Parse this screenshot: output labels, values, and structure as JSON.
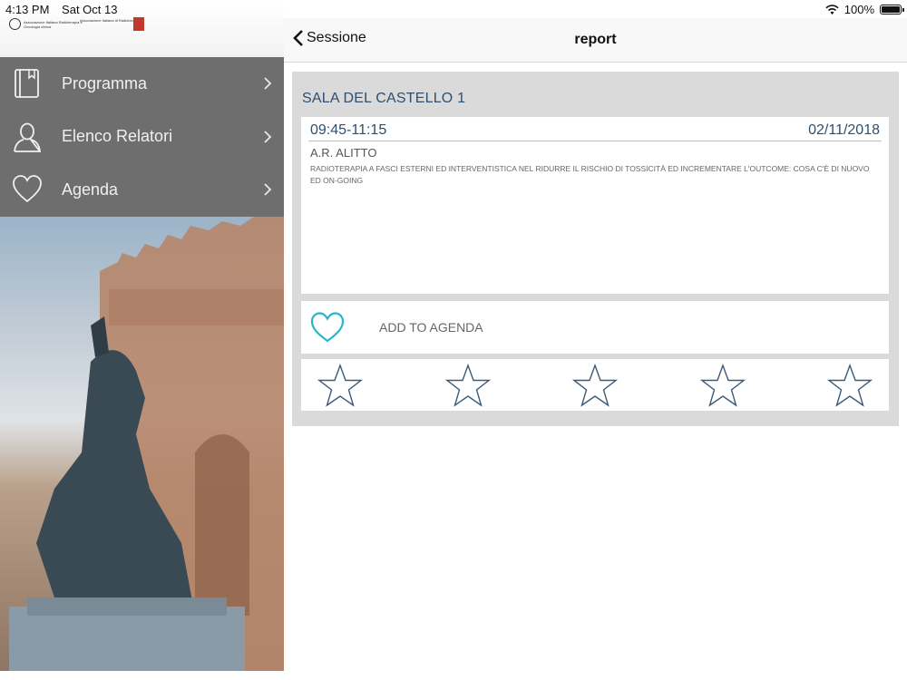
{
  "status_bar": {
    "time": "4:13 PM",
    "date": "Sat Oct 13",
    "battery": "100%",
    "battery_level": 1.0
  },
  "sidebar": {
    "logos": {
      "left_text": "Associazione Italiana Radioterapia e Oncologia clinica",
      "right_text": "Associazione Italiana di Radiobiologia"
    },
    "menu": [
      {
        "label": "Programma",
        "icon": "book-icon"
      },
      {
        "label": "Elenco Relatori",
        "icon": "person-icon"
      },
      {
        "label": "Agenda",
        "icon": "heart-icon"
      }
    ]
  },
  "nav": {
    "back_label": "Sessione",
    "title": "report"
  },
  "session": {
    "room": "SALA DEL CASTELLO 1",
    "time": "09:45-11:15",
    "date": "02/11/2018",
    "speaker": "A.R. ALITTO",
    "talk_title": "RADIOTERAPIA A FASCI ESTERNI ED INTERVENTISTICA NEL RIDURRE IL RISCHIO DI TOSSICITÀ ED INCREMENTARE L'OUTCOME: COSA C'È DI NUOVO ED ON-GOING"
  },
  "agenda": {
    "label": "ADD TO AGENDA"
  },
  "rating": {
    "max": 5,
    "value": 0
  },
  "colors": {
    "accent": "#2bb5c8",
    "title_blue": "#2f4f6f",
    "menu_bg": "#6e6e6e",
    "star": "#3d5a7a"
  }
}
